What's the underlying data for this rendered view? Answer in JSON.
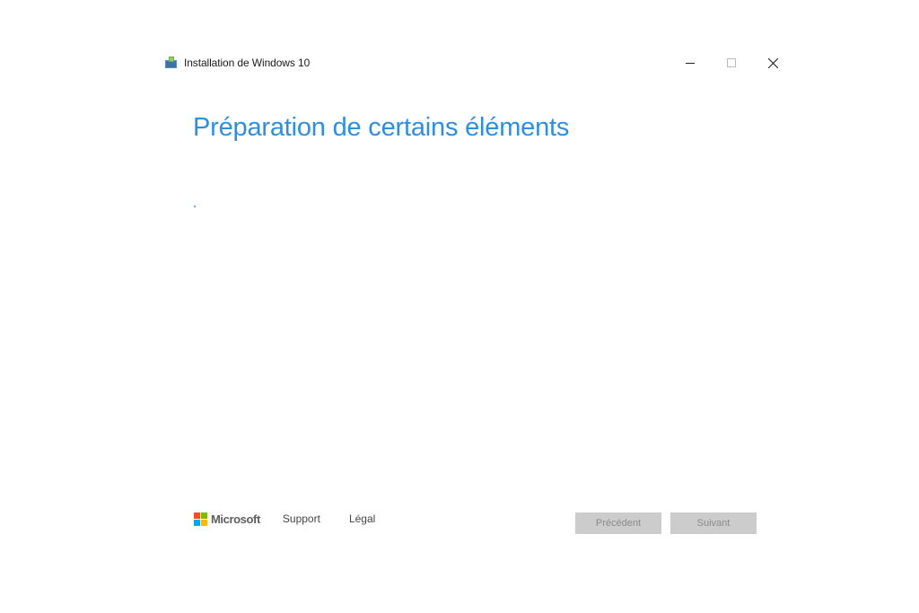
{
  "window": {
    "title": "Installation de Windows 10",
    "icon": "windows-setup-icon",
    "controls": {
      "minimize": "minimize-icon",
      "maximize": "maximize-icon",
      "close": "close-icon"
    }
  },
  "main": {
    "heading": "Préparation de certains éléments",
    "progress_indicator": "."
  },
  "footer": {
    "brand": "Microsoft",
    "links": [
      "Support",
      "Légal"
    ],
    "buttons": {
      "back": "Précédent",
      "next": "Suivant"
    }
  },
  "colors": {
    "accent": "#2f8fdd",
    "button_disabled_bg": "#cccccc",
    "button_disabled_text": "#8a8a8a",
    "ms_red": "#f25022",
    "ms_green": "#7fba00",
    "ms_blue": "#00a4ef",
    "ms_yellow": "#ffb900"
  }
}
